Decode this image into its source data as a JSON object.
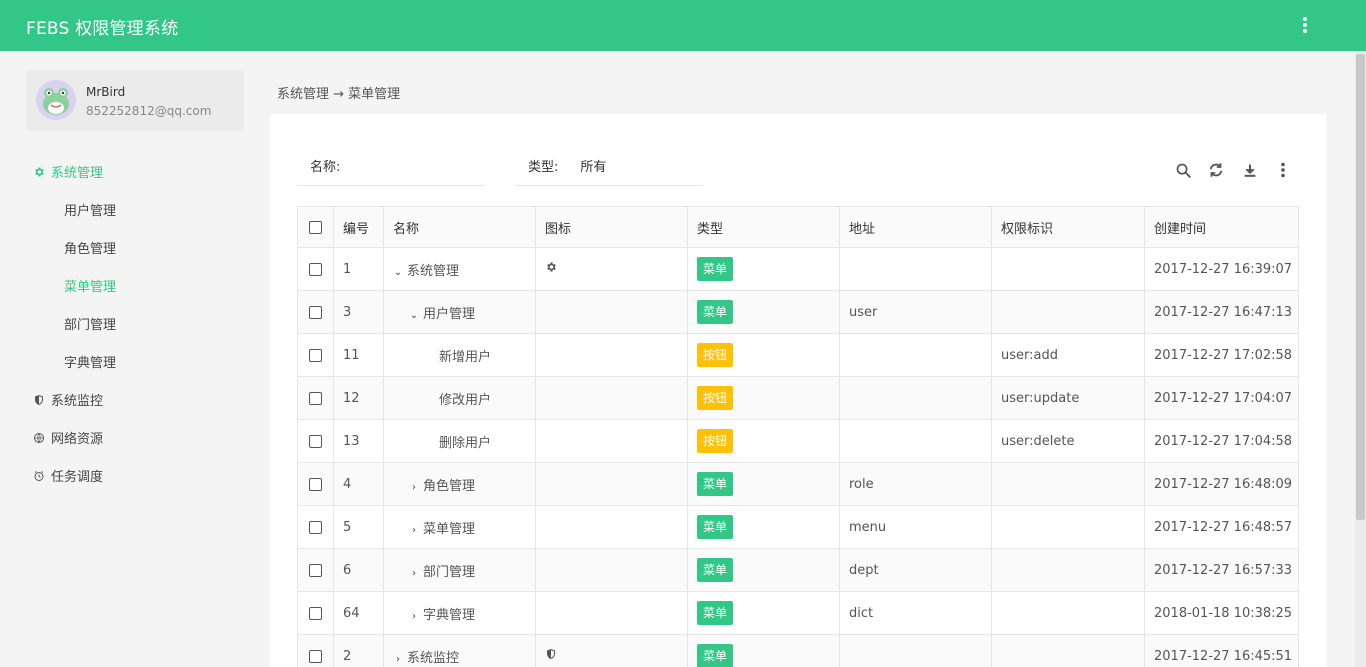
{
  "app": {
    "title": "FEBS 权限管理系统"
  },
  "user": {
    "name": "MrBird",
    "email": "852252812@qq.com"
  },
  "sidebar": {
    "items": [
      {
        "label": "系统管理",
        "icon": "gear-icon"
      },
      {
        "label": "用户管理"
      },
      {
        "label": "角色管理"
      },
      {
        "label": "菜单管理"
      },
      {
        "label": "部门管理"
      },
      {
        "label": "字典管理"
      },
      {
        "label": "系统监控",
        "icon": "shield-icon"
      },
      {
        "label": "网络资源",
        "icon": "globe-icon"
      },
      {
        "label": "任务调度",
        "icon": "clock-icon"
      }
    ]
  },
  "breadcrumb": {
    "text": "系统管理 → 菜单管理"
  },
  "filters": {
    "name_label": "名称:",
    "type_label": "类型:",
    "type_value": "所有"
  },
  "toolbar": {
    "icons": [
      "search-icon",
      "refresh-icon",
      "download-icon",
      "more-icon"
    ]
  },
  "table": {
    "columns": [
      "编号",
      "名称",
      "图标",
      "类型",
      "地址",
      "权限标识",
      "创建时间"
    ],
    "rows": [
      {
        "id": "1",
        "name": "系统管理",
        "arrow": "⌄",
        "icon": "gear-icon",
        "type": "菜单",
        "url": "",
        "perm": "",
        "time": "2017-12-27 16:39:07"
      },
      {
        "id": "3",
        "name": "用户管理",
        "arrow": "⌄",
        "icon": "",
        "type": "菜单",
        "url": "user",
        "perm": "",
        "time": "2017-12-27 16:47:13"
      },
      {
        "id": "11",
        "name": "新增用户",
        "arrow": "",
        "icon": "",
        "type": "按钮",
        "url": "",
        "perm": "user:add",
        "time": "2017-12-27 17:02:58"
      },
      {
        "id": "12",
        "name": "修改用户",
        "arrow": "",
        "icon": "",
        "type": "按钮",
        "url": "",
        "perm": "user:update",
        "time": "2017-12-27 17:04:07"
      },
      {
        "id": "13",
        "name": "删除用户",
        "arrow": "",
        "icon": "",
        "type": "按钮",
        "url": "",
        "perm": "user:delete",
        "time": "2017-12-27 17:04:58"
      },
      {
        "id": "4",
        "name": "角色管理",
        "arrow": "›",
        "icon": "",
        "type": "菜单",
        "url": "role",
        "perm": "",
        "time": "2017-12-27 16:48:09"
      },
      {
        "id": "5",
        "name": "菜单管理",
        "arrow": "›",
        "icon": "",
        "type": "菜单",
        "url": "menu",
        "perm": "",
        "time": "2017-12-27 16:48:57"
      },
      {
        "id": "6",
        "name": "部门管理",
        "arrow": "›",
        "icon": "",
        "type": "菜单",
        "url": "dept",
        "perm": "",
        "time": "2017-12-27 16:57:33"
      },
      {
        "id": "64",
        "name": "字典管理",
        "arrow": "›",
        "icon": "",
        "type": "菜单",
        "url": "dict",
        "perm": "",
        "time": "2018-01-18 10:38:25"
      },
      {
        "id": "2",
        "name": "系统监控",
        "arrow": "›",
        "icon": "shield-icon",
        "type": "菜单",
        "url": "",
        "perm": "",
        "time": "2017-12-27 16:45:51"
      }
    ]
  },
  "colors": {
    "accent": "#32c787",
    "button_badge": "#ffc107"
  }
}
